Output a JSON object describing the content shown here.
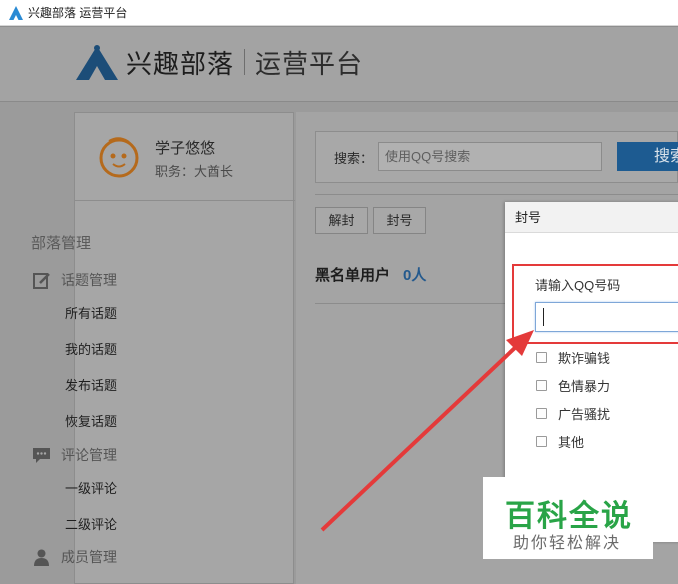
{
  "window": {
    "title": "兴趣部落 运营平台"
  },
  "header": {
    "brand": "兴趣部落",
    "platform": "运营平台"
  },
  "profile": {
    "name": "学子悠悠",
    "role": "职务：大酋长"
  },
  "sidebar": {
    "section": "部落管理",
    "groups": [
      {
        "label": "话题管理",
        "icon": "edit-icon",
        "items": [
          "所有话题",
          "我的话题",
          "发布话题",
          "恢复话题"
        ]
      },
      {
        "label": "评论管理",
        "icon": "comment-icon",
        "items": [
          "一级评论",
          "二级评论"
        ]
      },
      {
        "label": "成员管理",
        "icon": "user-icon",
        "items": []
      }
    ]
  },
  "search": {
    "label": "搜索：",
    "placeholder": "使用QQ号搜索",
    "button": "搜索"
  },
  "actions": {
    "unban": "解封",
    "ban": "封号"
  },
  "blacklist": {
    "label": "黑名单用户",
    "count": "0人"
  },
  "modal": {
    "title": "封号",
    "qq_label": "请输入QQ号码",
    "qq_value": "",
    "options": [
      "欺诈骗钱",
      "色情暴力",
      "广告骚扰",
      "其他"
    ]
  },
  "watermark": {
    "title": "百科全说",
    "subtitle": "助你轻松解决"
  },
  "colors": {
    "accent": "#1d5b91",
    "highlight": "#e43a3a",
    "watermark": "#29a447"
  }
}
